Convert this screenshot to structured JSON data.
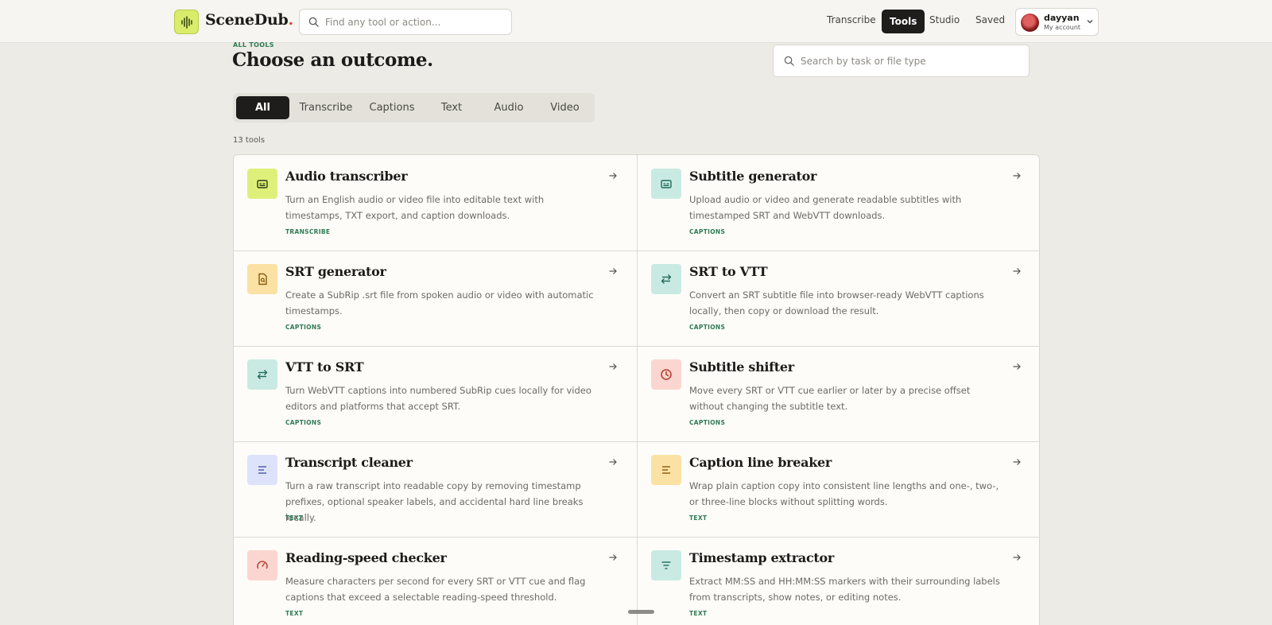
{
  "header": {
    "brand": "SceneDub",
    "brand_dot": ".",
    "search_placeholder": "Find any tool or action...",
    "nav": [
      {
        "label": "Transcribe"
      },
      {
        "label": "Tools"
      },
      {
        "label": "Studio"
      },
      {
        "label": "Saved"
      }
    ],
    "active_nav": "Tools",
    "account": {
      "name": "dayyan",
      "subtitle": "My account"
    }
  },
  "main": {
    "eyebrow": "ALL TOOLS",
    "title": "Choose an outcome.",
    "search_placeholder": "Search by task or file type",
    "filters": [
      "All",
      "Transcribe",
      "Captions",
      "Text",
      "Audio",
      "Video"
    ],
    "active_filter": "All",
    "tool_count": "13 tools"
  },
  "tools": [
    {
      "title": "Audio transcriber",
      "description": "Turn an English audio or video file into editable text with timestamps, TXT export, and caption downloads.",
      "category": "TRANSCRIBE",
      "icon": "captions-icon",
      "icon_bg": "#dff07a",
      "icon_color": "#2b3a10"
    },
    {
      "title": "Subtitle generator",
      "description": "Upload audio or video and generate readable subtitles with timestamped SRT and WebVTT downloads.",
      "category": "CAPTIONS",
      "icon": "captions-icon",
      "icon_bg": "#c9eae3",
      "icon_color": "#1f6b5a"
    },
    {
      "title": "SRT generator",
      "description": "Create a SubRip .srt file from spoken audio or video with automatic timestamps.",
      "category": "CAPTIONS",
      "icon": "file-search-icon",
      "icon_bg": "#fbe2a4",
      "icon_color": "#8a5a10"
    },
    {
      "title": "SRT to VTT",
      "description": "Convert an SRT subtitle file into browser-ready WebVTT captions locally, then copy or download the result.",
      "category": "CAPTIONS",
      "icon": "swap-arrows-icon",
      "icon_bg": "#c9eae3",
      "icon_color": "#1f6b5a"
    },
    {
      "title": "VTT to SRT",
      "description": "Turn WebVTT captions into numbered SubRip cues locally for video editors and platforms that accept SRT.",
      "category": "CAPTIONS",
      "icon": "swap-arrows-icon",
      "icon_bg": "#c9eae3",
      "icon_color": "#1f6b5a"
    },
    {
      "title": "Subtitle shifter",
      "description": "Move every SRT or VTT cue earlier or later by a precise offset without changing the subtitle text.",
      "category": "CAPTIONS",
      "icon": "clock-icon",
      "icon_bg": "#fbd6d0",
      "icon_color": "#b23a2a"
    },
    {
      "title": "Transcript cleaner",
      "description": "Turn a raw transcript into readable copy by removing timestamp prefixes, optional speaker labels, and accidental hard line breaks locally.",
      "category": "TEXT",
      "icon": "align-left-icon",
      "icon_bg": "#dde3fa",
      "icon_color": "#4a56a8"
    },
    {
      "title": "Caption line breaker",
      "description": "Wrap plain caption copy into consistent line lengths and one-, two-, or three-line blocks without splitting words.",
      "category": "TEXT",
      "icon": "align-left-icon",
      "icon_bg": "#fbe2a4",
      "icon_color": "#8a5a10"
    },
    {
      "title": "Reading-speed checker",
      "description": "Measure characters per second for every SRT or VTT cue and flag captions that exceed a selectable reading-speed threshold.",
      "category": "TEXT",
      "icon": "gauge-icon",
      "icon_bg": "#fbd6d0",
      "icon_color": "#b23a2a"
    },
    {
      "title": "Timestamp extractor",
      "description": "Extract MM:SS and HH:MM:SS markers with their surrounding labels from transcripts, show notes, or editing notes.",
      "category": "TEXT",
      "icon": "filter-lines-icon",
      "icon_bg": "#c9eae3",
      "icon_color": "#1f6b5a"
    }
  ]
}
